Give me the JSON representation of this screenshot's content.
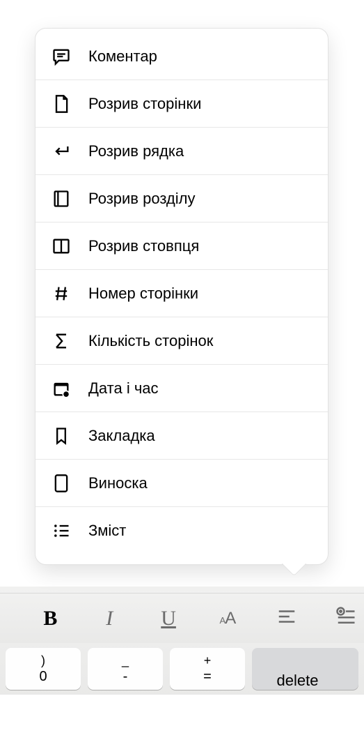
{
  "menu": {
    "items": [
      {
        "label": "Коментар"
      },
      {
        "label": "Розрив сторінки"
      },
      {
        "label": "Розрив рядка"
      },
      {
        "label": "Розрив розділу"
      },
      {
        "label": "Розрив стовпця"
      },
      {
        "label": "Номер сторінки"
      },
      {
        "label": "Кількість сторінок"
      },
      {
        "label": "Дата і час"
      },
      {
        "label": "Закладка"
      },
      {
        "label": "Виноска"
      },
      {
        "label": "Зміст"
      }
    ]
  },
  "format_bar": {
    "bold": "B",
    "italic": "I",
    "underline": "U",
    "text_style": "aA"
  },
  "keyboard": {
    "k1_top": ")",
    "k1_bot": "0",
    "k2_top": "_",
    "k2_bot": "-",
    "k3_top": "+",
    "k3_bot": "=",
    "delete": "delete"
  }
}
